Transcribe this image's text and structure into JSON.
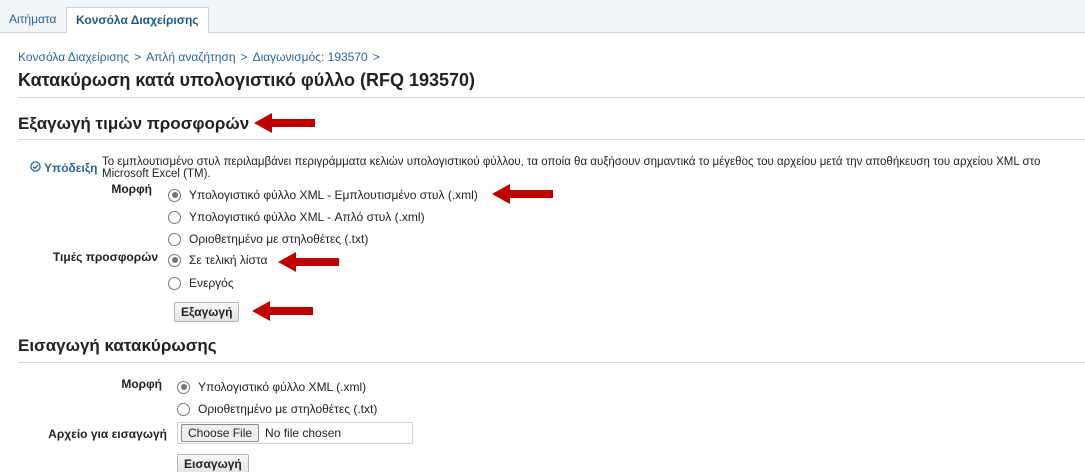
{
  "tabs": [
    {
      "label": "Αιτήματα"
    },
    {
      "label": "Κονσόλα Διαχείρισης"
    }
  ],
  "breadcrumb": {
    "items": [
      "Κονσόλα Διαχείρισης",
      "Απλή αναζήτηση",
      "Διαγωνισμός: 193570"
    ],
    "separator": ">"
  },
  "page_title": "Κατακύρωση κατά υπολογιστικό φύλλο (RFQ 193570)",
  "export_section": {
    "title": "Εξαγωγή τιμών προσφορών",
    "hint_label": "Υπόδειξη",
    "hint_text": "Το εμπλουτισμένο στυλ περιλαμβάνει περιγράμματα κελιών υπολογιστικού φύλλου, τα οποία θα αυξήσουν σημαντικά το μέγεθος του αρχείου μετά την αποθήκευση του αρχείου XML στο Microsoft Excel (TM).",
    "format_label": "Μορφή",
    "format_options": [
      {
        "label": "Υπολογιστικό φύλλο XML - Εμπλουτισμένο στυλ (.xml)",
        "selected": true
      },
      {
        "label": "Υπολογιστικό φύλλο XML - Απλό στυλ (.xml)",
        "selected": false
      },
      {
        "label": "Οριοθετημένο με στηλοθέτες (.txt)",
        "selected": false
      }
    ],
    "prices_label": "Τιμές προσφορών",
    "prices_options": [
      {
        "label": "Σε τελική λίστα",
        "selected": true
      },
      {
        "label": "Ενεργός",
        "selected": false
      }
    ],
    "export_button": "Εξαγωγή"
  },
  "import_section": {
    "title": "Εισαγωγή κατακύρωσης",
    "format_label": "Μορφή",
    "format_options": [
      {
        "label": "Υπολογιστικό φύλλο XML (.xml)",
        "selected": true
      },
      {
        "label": "Οριοθετημένο με στηλοθέτες (.txt)",
        "selected": false
      }
    ],
    "file_label": "Αρχείο για εισαγωγή",
    "choose_file_button": "Choose File",
    "file_status": "No file chosen",
    "import_button": "Εισαγωγή"
  },
  "colors": {
    "link": "#2a6496",
    "annotation_arrow": "#c00000"
  },
  "icons": {
    "hint": "check-circle-icon",
    "annotation": "arrow-left-icon"
  }
}
